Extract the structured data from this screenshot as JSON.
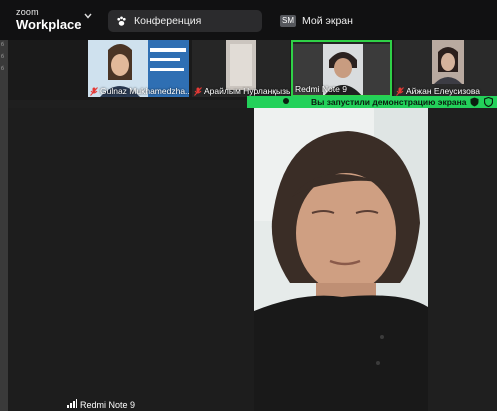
{
  "brand": {
    "small": "zoom",
    "name": "Workplace"
  },
  "tabs": [
    {
      "label": "Конференция",
      "active": true
    },
    {
      "label": "Мой экран",
      "badge": "SM",
      "active": false
    }
  ],
  "left_edge_text": [
    "б",
    "б",
    "б"
  ],
  "participants": [
    {
      "name": "Gulnaz Mukhamedzha...",
      "muted": true
    },
    {
      "name": "Арайлым Нурланқызы",
      "muted": true
    },
    {
      "name": "Redmi Note 9",
      "muted": false,
      "speaking": true
    },
    {
      "name": "Айжан Елеусизова",
      "muted": true
    }
  ],
  "share_banner": {
    "text": "Вы запустили демонстрацию экрана",
    "color": "#23d15a"
  },
  "active_speaker": {
    "label": "Redmi Note 9"
  },
  "colors": {
    "speaking_border": "#2fd147",
    "topbar": "#111112",
    "stage": "#1d1d1d"
  }
}
